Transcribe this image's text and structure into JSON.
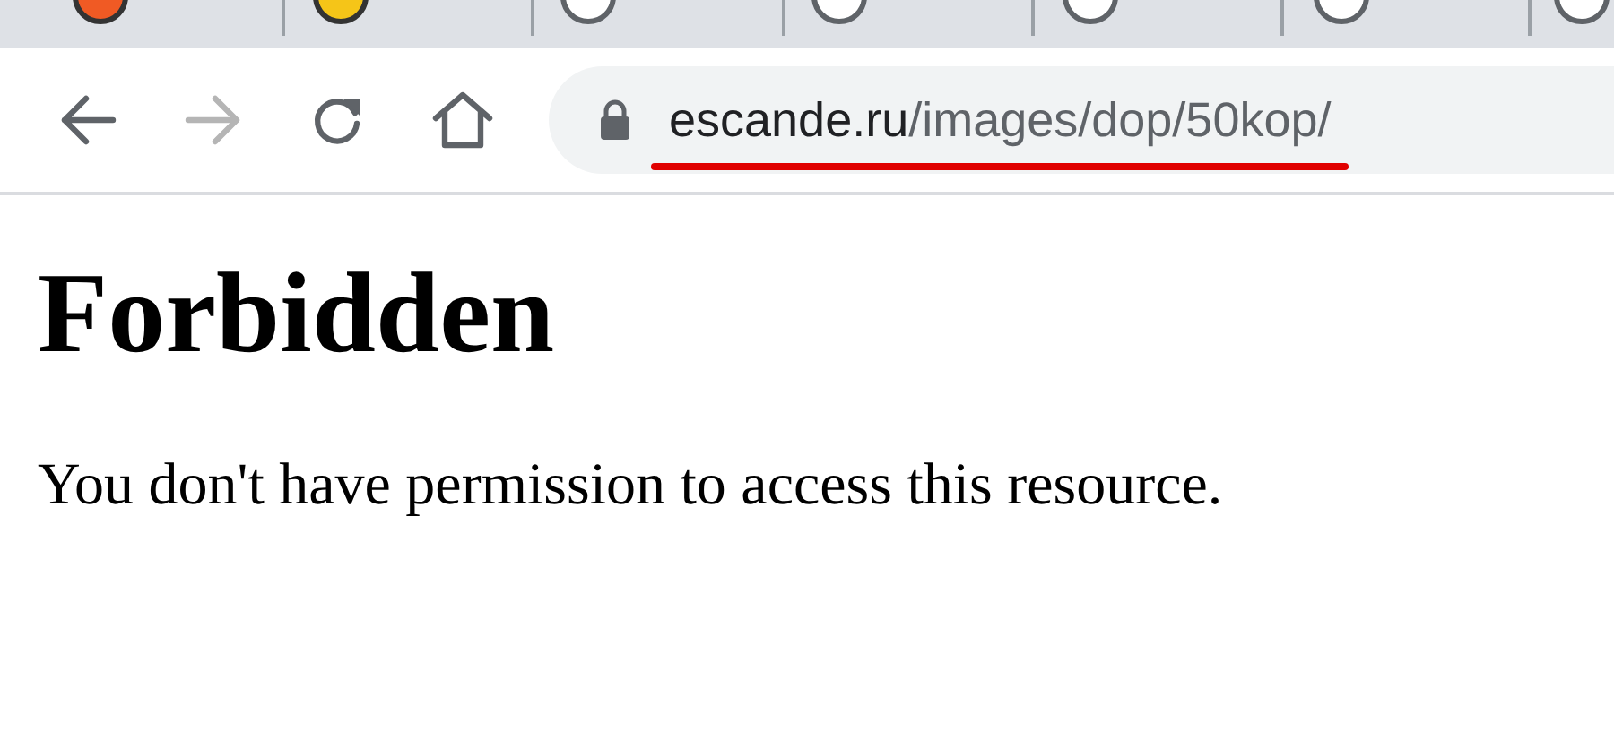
{
  "toolbar": {
    "back": {
      "disabled": false
    },
    "forward": {
      "disabled": true
    }
  },
  "address_bar": {
    "domain": "escande.ru",
    "path": "/images/dop/50kop/"
  },
  "page": {
    "heading": "Forbidden",
    "message": "You don't have permission to access this resource."
  }
}
